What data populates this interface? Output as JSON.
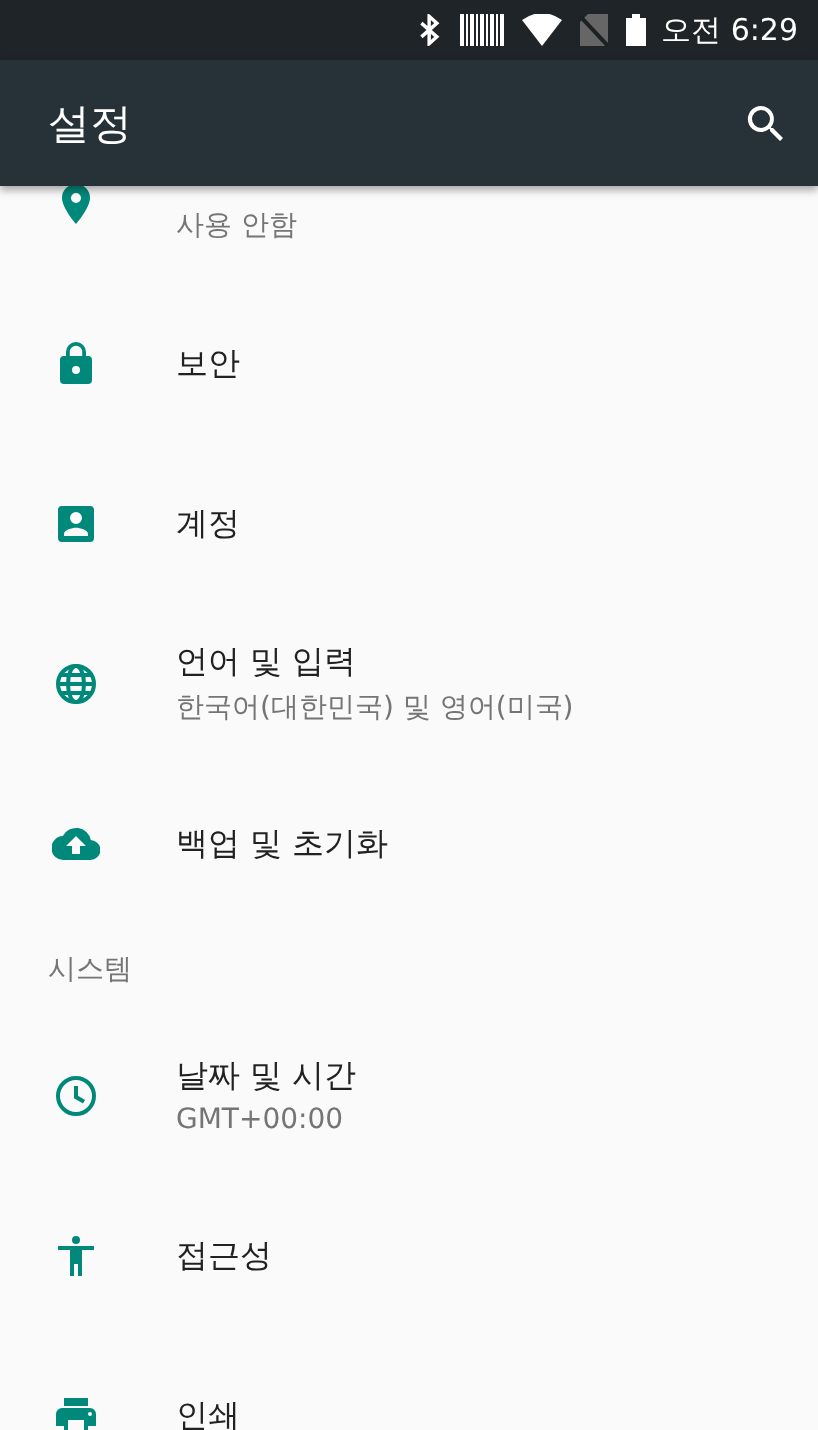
{
  "status_bar": {
    "time": "오전 6:29"
  },
  "toolbar": {
    "title": "설정"
  },
  "items": [
    {
      "kind": "setting",
      "subtitle": "사용 안함"
    },
    {
      "kind": "setting",
      "title": "보안"
    },
    {
      "kind": "setting",
      "title": "계정"
    },
    {
      "kind": "setting",
      "title": "언어 및 입력",
      "subtitle": "한국어(대한민국) 및 영어(미국)"
    },
    {
      "kind": "setting",
      "title": "백업 및 초기화"
    },
    {
      "kind": "header",
      "title": "시스템"
    },
    {
      "kind": "setting",
      "title": "날짜 및 시간",
      "subtitle": "GMT+00:00"
    },
    {
      "kind": "setting",
      "title": "접근성"
    },
    {
      "kind": "setting",
      "title": "인쇄"
    }
  ]
}
